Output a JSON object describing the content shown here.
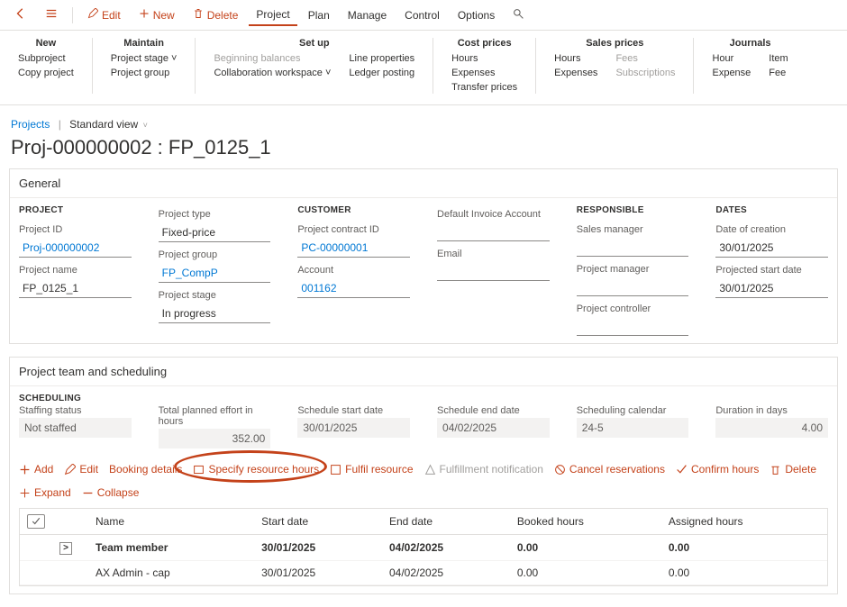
{
  "toolbar": {
    "edit": "Edit",
    "new": "New",
    "delete": "Delete",
    "tabs": [
      "Project",
      "Plan",
      "Manage",
      "Control",
      "Options"
    ]
  },
  "ribbon": {
    "groups": [
      {
        "title": "New",
        "cols": [
          [
            "Subproject",
            "Copy project"
          ]
        ]
      },
      {
        "title": "Maintain",
        "cols": [
          [
            "Project stage ˅",
            "Project group"
          ]
        ]
      },
      {
        "title": "Set up",
        "cols": [
          [
            "Beginning balances",
            "Collaboration workspace ˅"
          ],
          [
            "Line properties",
            "Ledger posting"
          ]
        ]
      },
      {
        "title": "Cost prices",
        "cols": [
          [
            "Hours",
            "Expenses",
            "Transfer prices"
          ]
        ]
      },
      {
        "title": "Sales prices",
        "cols": [
          [
            "Hours",
            "Expenses"
          ],
          [
            "Fees",
            "Subscriptions"
          ]
        ]
      },
      {
        "title": "Journals",
        "cols": [
          [
            "Hour",
            "Expense"
          ],
          [
            "Item",
            "Fee"
          ]
        ]
      }
    ]
  },
  "breadcrumb": {
    "root": "Projects",
    "view": "Standard view"
  },
  "page_title": "Proj-000000002 : FP_0125_1",
  "general": {
    "header": "General",
    "project": {
      "head": "PROJECT",
      "id_label": "Project ID",
      "id": "Proj-000000002",
      "name_label": "Project name",
      "name": "FP_0125_1"
    },
    "ptype": {
      "type_label": "Project type",
      "type": "Fixed-price",
      "group_label": "Project group",
      "group": "FP_CompP",
      "stage_label": "Project stage",
      "stage": "In progress"
    },
    "customer": {
      "head": "CUSTOMER",
      "contract_label": "Project contract ID",
      "contract": "PC-00000001",
      "account_label": "Account",
      "account": "001162"
    },
    "invoice": {
      "def_label": "Default Invoice Account",
      "def": "",
      "email_label": "Email",
      "email": ""
    },
    "responsible": {
      "head": "RESPONSIBLE",
      "sm_label": "Sales manager",
      "sm": "",
      "pm_label": "Project manager",
      "pm": "",
      "pc_label": "Project controller",
      "pc": ""
    },
    "dates": {
      "head": "DATES",
      "created_label": "Date of creation",
      "created": "30/01/2025",
      "projstart_label": "Projected start date",
      "projstart": "30/01/2025"
    }
  },
  "scheduling": {
    "header": "Project team and scheduling",
    "section": "SCHEDULING",
    "status_label": "Staffing status",
    "status": "Not staffed",
    "effort_label": "Total planned effort in hours",
    "effort": "352.00",
    "start_label": "Schedule start date",
    "start": "30/01/2025",
    "end_label": "Schedule end date",
    "end": "04/02/2025",
    "cal_label": "Scheduling calendar",
    "cal": "24-5",
    "dur_label": "Duration in days",
    "dur": "4.00",
    "actions": {
      "add": "Add",
      "edit": "Edit",
      "booking": "Booking details",
      "specify": "Specify resource hours",
      "fulfil": "Fulfil resource",
      "fulnotif": "Fulfillment notification",
      "cancel": "Cancel reservations",
      "confirm": "Confirm hours",
      "delete": "Delete",
      "expand": "Expand",
      "collapse": "Collapse"
    },
    "columns": {
      "name": "Name",
      "start": "Start date",
      "end": "End date",
      "booked": "Booked hours",
      "assigned": "Assigned hours"
    },
    "rows": [
      {
        "bold": true,
        "expand": true,
        "name": "Team member",
        "start": "30/01/2025",
        "end": "04/02/2025",
        "booked": "0.00",
        "assigned": "0.00"
      },
      {
        "bold": false,
        "expand": false,
        "name": "AX Admin - cap",
        "start": "30/01/2025",
        "end": "04/02/2025",
        "booked": "0.00",
        "assigned": "0.00"
      }
    ]
  }
}
